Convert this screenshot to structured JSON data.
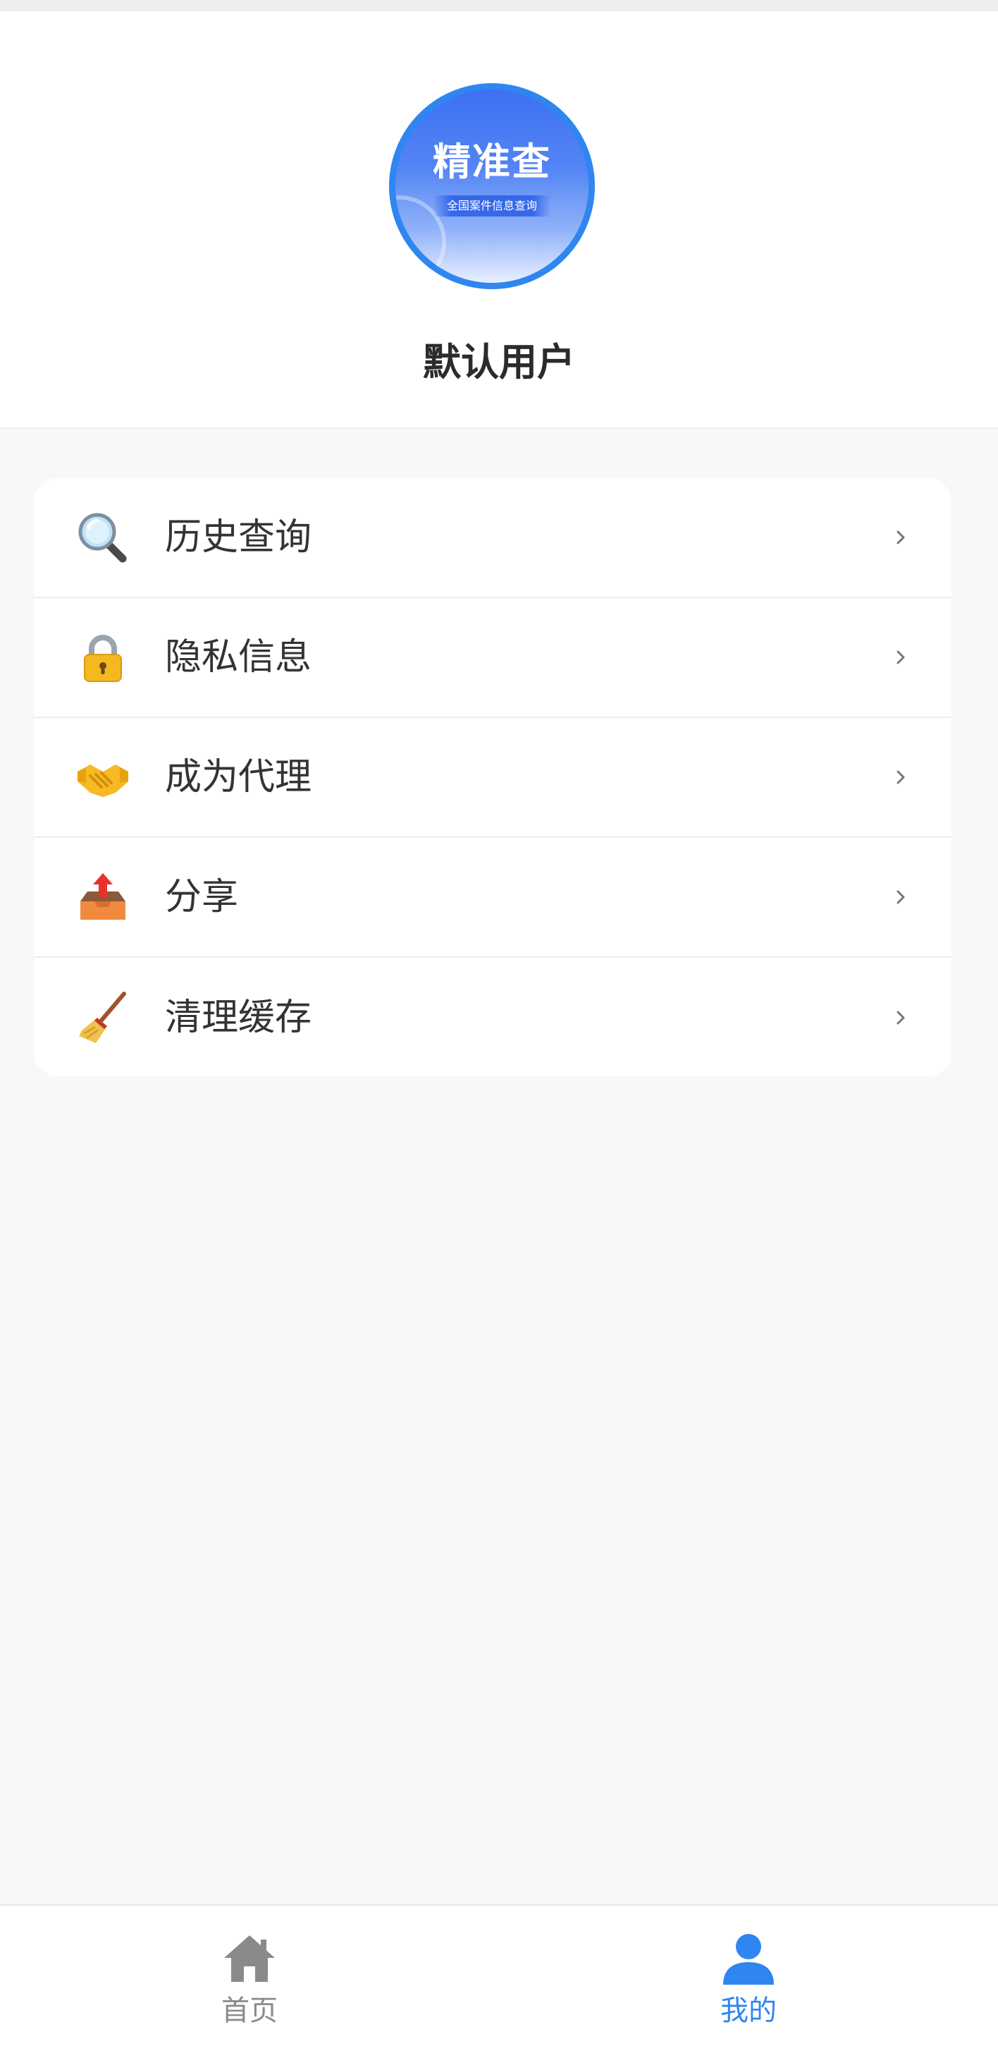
{
  "profile": {
    "avatar_title": "精准查",
    "avatar_subtitle": "全国案件信息查询",
    "user_name": "默认用户"
  },
  "menu": {
    "items": [
      {
        "label": "历史查询",
        "icon": "magnifier-icon"
      },
      {
        "label": "隐私信息",
        "icon": "lock-icon"
      },
      {
        "label": "成为代理",
        "icon": "handshake-icon"
      },
      {
        "label": "分享",
        "icon": "outbox-tray-icon"
      },
      {
        "label": "清理缓存",
        "icon": "broom-icon"
      }
    ],
    "chevron": "›"
  },
  "tab_bar": {
    "tabs": [
      {
        "label": "首页",
        "icon": "home-icon",
        "active": false
      },
      {
        "label": "我的",
        "icon": "user-icon",
        "active": true
      }
    ]
  },
  "colors": {
    "accent": "#2f86f0",
    "tab_inactive": "#8a8a8a",
    "tab_active": "#2f86f0",
    "page_background": "#f8f8f8"
  }
}
